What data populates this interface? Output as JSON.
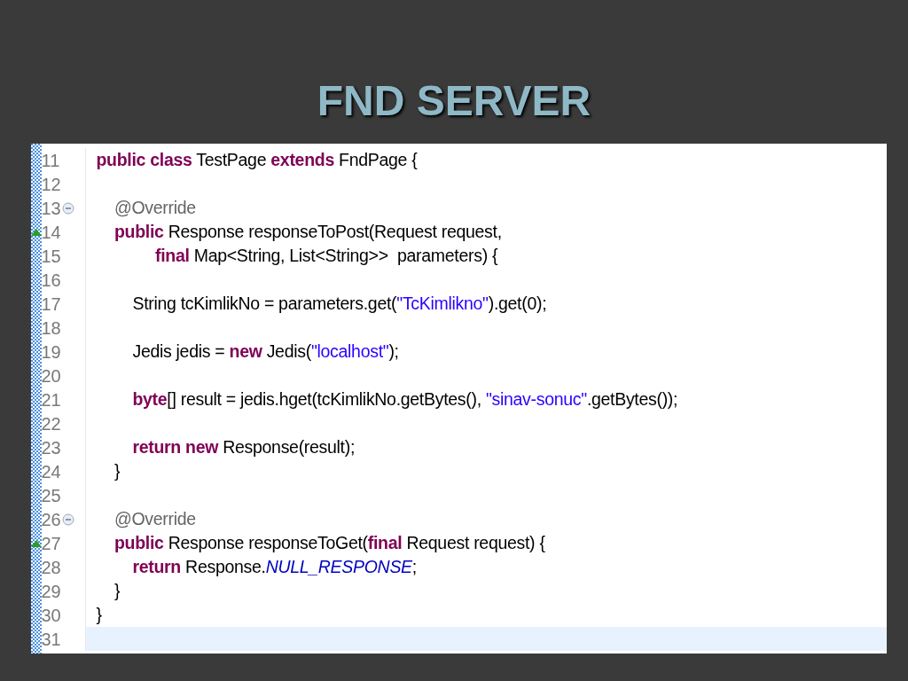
{
  "title": "FND SERVER",
  "code": {
    "lines": [
      {
        "number": "11",
        "fold": false,
        "marker": false,
        "current": false,
        "tokens": [
          {
            "kind": "keyword",
            "text": "public class"
          },
          {
            "kind": "plain",
            "text": " TestPage "
          },
          {
            "kind": "keyword",
            "text": "extends"
          },
          {
            "kind": "plain",
            "text": " FndPage {"
          }
        ]
      },
      {
        "number": "12",
        "fold": false,
        "marker": false,
        "current": false
      },
      {
        "number": "13",
        "fold": true,
        "marker": false,
        "current": false,
        "tokens": [
          {
            "kind": "annotation",
            "text": "    @Override"
          }
        ]
      },
      {
        "number": "14",
        "fold": false,
        "marker": true,
        "current": false,
        "tokens": [
          {
            "kind": "keyword",
            "text": "    public"
          },
          {
            "kind": "plain",
            "text": " Response responseToPost(Request request,"
          }
        ]
      },
      {
        "number": "15",
        "fold": false,
        "marker": false,
        "current": false,
        "tokens": [
          {
            "kind": "keyword",
            "text": "             final"
          },
          {
            "kind": "plain",
            "text": " Map<String, List<String>>  parameters) {"
          }
        ]
      },
      {
        "number": "16",
        "fold": false,
        "marker": false,
        "current": false
      },
      {
        "number": "17",
        "fold": false,
        "marker": false,
        "current": false,
        "tokens": [
          {
            "kind": "plain",
            "text": "        String tcKimlikNo = parameters.get("
          },
          {
            "kind": "string",
            "text": "\"TcKimlikno\""
          },
          {
            "kind": "plain",
            "text": ").get(0);"
          }
        ]
      },
      {
        "number": "18",
        "fold": false,
        "marker": false,
        "current": false
      },
      {
        "number": "19",
        "fold": false,
        "marker": false,
        "current": false,
        "tokens": [
          {
            "kind": "plain",
            "text": "        Jedis jedis = "
          },
          {
            "kind": "keyword",
            "text": "new"
          },
          {
            "kind": "plain",
            "text": " Jedis("
          },
          {
            "kind": "string",
            "text": "\"localhost\""
          },
          {
            "kind": "plain",
            "text": ");"
          }
        ]
      },
      {
        "number": "20",
        "fold": false,
        "marker": false,
        "current": false
      },
      {
        "number": "21",
        "fold": false,
        "marker": false,
        "current": false,
        "tokens": [
          {
            "kind": "keyword",
            "text": "        byte"
          },
          {
            "kind": "plain",
            "text": "[] result = jedis.hget(tcKimlikNo.getBytes(), "
          },
          {
            "kind": "string",
            "text": "\"sinav-sonuc\""
          },
          {
            "kind": "plain",
            "text": ".getBytes());"
          }
        ]
      },
      {
        "number": "22",
        "fold": false,
        "marker": false,
        "current": false
      },
      {
        "number": "23",
        "fold": false,
        "marker": false,
        "current": false,
        "tokens": [
          {
            "kind": "keyword",
            "text": "        return new"
          },
          {
            "kind": "plain",
            "text": " Response(result);"
          }
        ]
      },
      {
        "number": "24",
        "fold": false,
        "marker": false,
        "current": false,
        "tokens": [
          {
            "kind": "plain",
            "text": "    }"
          }
        ]
      },
      {
        "number": "25",
        "fold": false,
        "marker": false,
        "current": false
      },
      {
        "number": "26",
        "fold": true,
        "marker": false,
        "current": false,
        "tokens": [
          {
            "kind": "annotation",
            "text": "    @Override"
          }
        ]
      },
      {
        "number": "27",
        "fold": false,
        "marker": true,
        "current": false,
        "tokens": [
          {
            "kind": "keyword",
            "text": "    public"
          },
          {
            "kind": "plain",
            "text": " Response responseToGet("
          },
          {
            "kind": "keyword",
            "text": "final"
          },
          {
            "kind": "plain",
            "text": " Request request) {"
          }
        ]
      },
      {
        "number": "28",
        "fold": false,
        "marker": false,
        "current": false,
        "tokens": [
          {
            "kind": "keyword",
            "text": "        return"
          },
          {
            "kind": "plain",
            "text": " Response."
          },
          {
            "kind": "constant",
            "text": "NULL_RESPONSE"
          },
          {
            "kind": "plain",
            "text": ";"
          }
        ]
      },
      {
        "number": "29",
        "fold": false,
        "marker": false,
        "current": false,
        "tokens": [
          {
            "kind": "plain",
            "text": "    }"
          }
        ]
      },
      {
        "number": "30",
        "fold": false,
        "marker": false,
        "current": false,
        "tokens": [
          {
            "kind": "plain",
            "text": "}"
          }
        ]
      },
      {
        "number": "31",
        "fold": false,
        "marker": false,
        "current": true
      }
    ]
  }
}
